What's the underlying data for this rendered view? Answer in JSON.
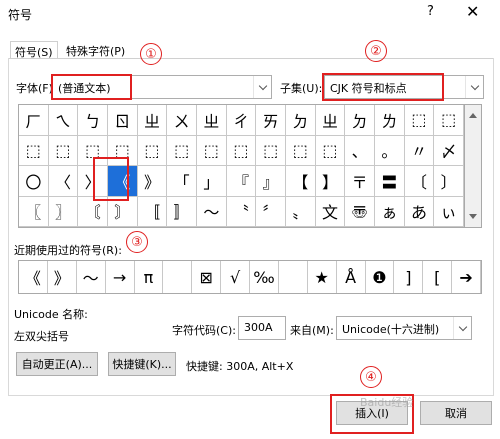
{
  "window": {
    "title": "符号",
    "help": "?",
    "close": "✕"
  },
  "tabs": [
    {
      "label": "符号(S)"
    },
    {
      "label": "特殊字符(P)"
    }
  ],
  "font": {
    "label": "字体(F):",
    "value": "(普通文本)"
  },
  "subset": {
    "label": "子集(U):",
    "value": "CJK 符号和标点"
  },
  "grid": [
    [
      "ㄏ",
      "ㄟ",
      "ㄅ",
      "ㄖ",
      "ㄓ",
      "ㄨ",
      "ㄓ",
      "ㄔ",
      "ㄞ",
      "ㄉ",
      "ㄓ",
      "ㄉ",
      "ㄌ",
      "⬚",
      "⬚"
    ],
    [
      "⬚",
      "⬚",
      "⬚",
      "⬚",
      "⬚",
      "⬚",
      "⬚",
      "⬚",
      "⬚",
      "⬚",
      "⬚",
      "、",
      "。",
      "〃",
      "〆"
    ],
    [
      "〇",
      "〈",
      "〉",
      "《",
      "》",
      "「",
      "」",
      "『",
      "』",
      "【",
      "】",
      "〒",
      "〓",
      "〔",
      "〕"
    ],
    [
      "〖",
      "〗",
      "〘",
      "〙",
      "〚",
      "〛",
      "〜",
      "〝",
      "〞",
      "〟",
      "文",
      "〠",
      "ぁ",
      "あ",
      "ぃ"
    ]
  ],
  "selected_char": "《",
  "recent": {
    "label": "近期使用过的符号(R):",
    "items": [
      "《",
      "》",
      "～",
      "→",
      "π",
      "",
      "⊠",
      "√",
      "‰",
      "",
      "★",
      "Å",
      "❶",
      "]",
      "[",
      "➔"
    ]
  },
  "unicode_name_label": "Unicode 名称:",
  "unicode_name_value": "左双尖括号",
  "charcode": {
    "label": "字符代码(C):",
    "value": "300A"
  },
  "from": {
    "label": "来自(M):",
    "value": "Unicode(十六进制)"
  },
  "buttons": {
    "autocorrect": "自动更正(A)...",
    "shortcut": "快捷键(K)...",
    "insert": "插入(I)",
    "cancel": "取消"
  },
  "shortcut_text": "快捷键: 300A, Alt+X",
  "markers": [
    "①",
    "②",
    "③",
    "④"
  ],
  "watermark": "Baidu经验",
  "accent": "#e02020"
}
